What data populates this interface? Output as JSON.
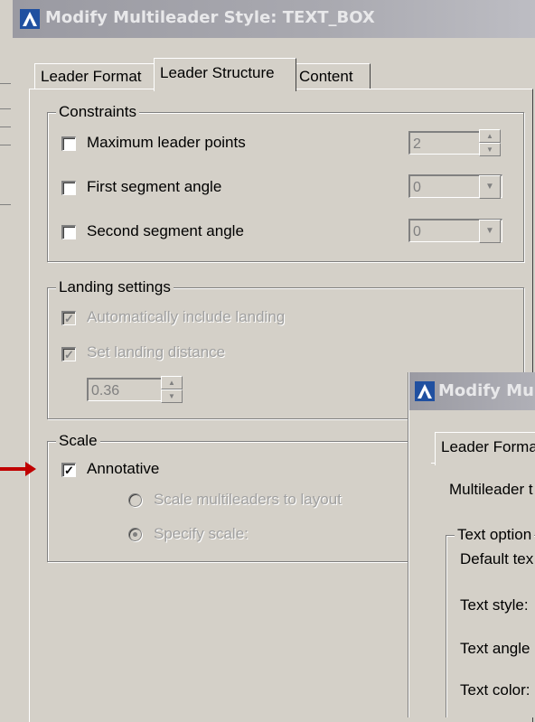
{
  "main_dialog": {
    "title": "Modify Multileader Style: TEXT_BOX",
    "tabs": [
      {
        "label": "Leader Format",
        "active": false
      },
      {
        "label": "Leader Structure",
        "active": true
      },
      {
        "label": "Content",
        "active": false
      }
    ],
    "constraints": {
      "legend": "Constraints",
      "max_leader_points": {
        "label": "Maximum leader points",
        "checked": false,
        "value": "2"
      },
      "first_segment_angle": {
        "label": "First segment angle",
        "checked": false,
        "value": "0"
      },
      "second_segment_angle": {
        "label": "Second segment angle",
        "checked": false,
        "value": "0"
      }
    },
    "landing": {
      "legend": "Landing settings",
      "auto_include": {
        "label": "Automatically include landing",
        "checked": true
      },
      "set_distance": {
        "label": "Set landing distance",
        "checked": true
      },
      "distance_value": "0.36"
    },
    "scale": {
      "legend": "Scale",
      "annotative": {
        "label": "Annotative",
        "checked": true
      },
      "scale_to_layout": {
        "label": "Scale multileaders to layout",
        "selected": false
      },
      "specify_scale": {
        "label": "Specify scale:",
        "selected": true
      }
    }
  },
  "second_dialog": {
    "title": "Modify Mul",
    "tab": "Leader Forma",
    "multileader_label": "Multileader t",
    "text_options_legend": "Text option",
    "default_text_label": "Default tex",
    "text_style_label": "Text style:",
    "text_angle_label": "Text angle",
    "text_color_label": "Text color:"
  },
  "colors": {
    "arrow": "#c00000",
    "titlebar": "#9a9aa2",
    "dialog_bg": "#d4d0c8"
  },
  "icons": {
    "app": "autocad-a-icon",
    "arrow": "red-pointer-arrow"
  }
}
